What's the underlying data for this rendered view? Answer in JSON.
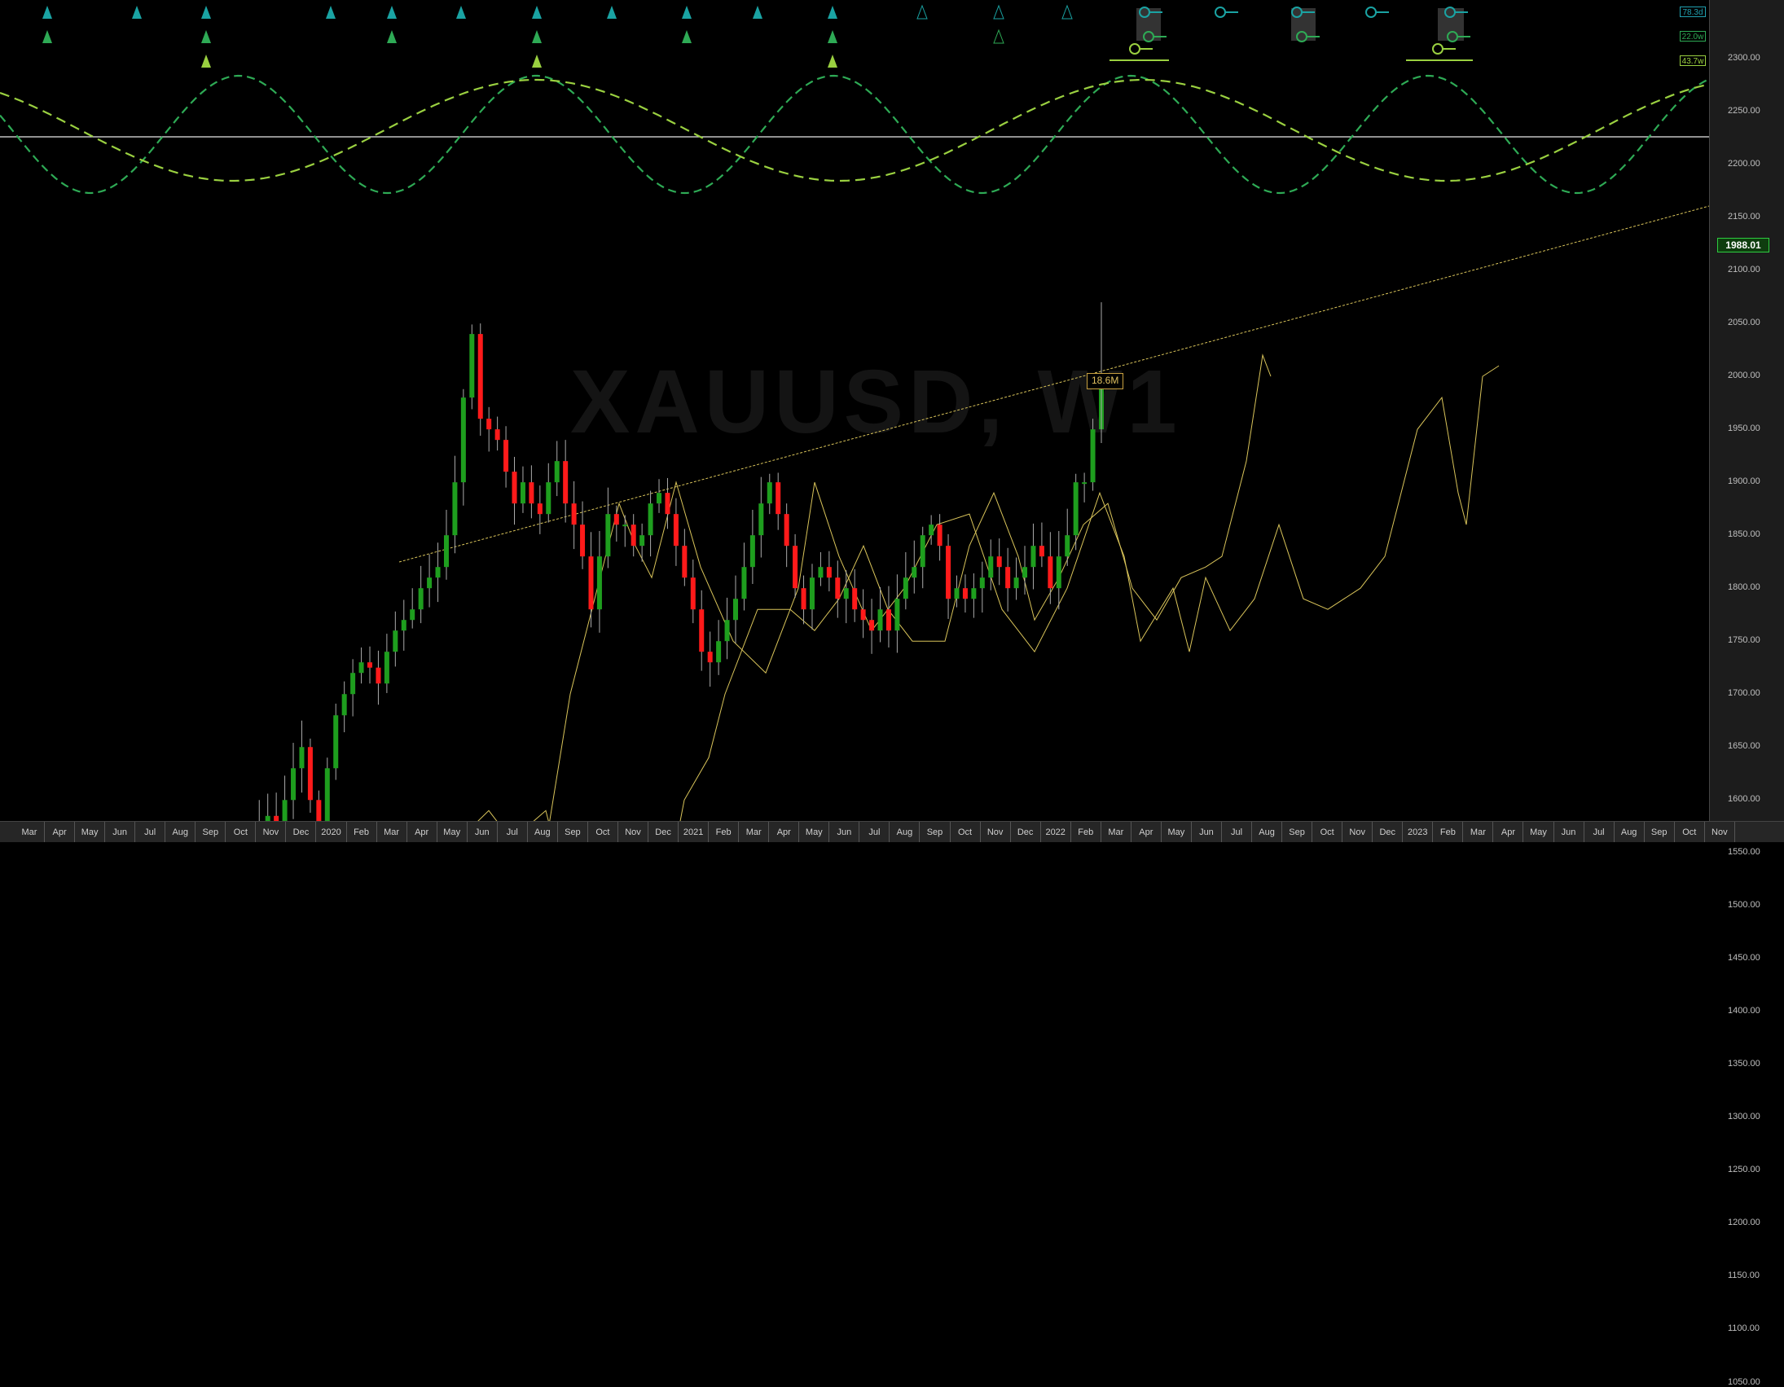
{
  "symbol_watermark": "XAUUSD, W1",
  "last_price": "1988.01",
  "volume_badge": "18.6M",
  "cycle_labels": [
    {
      "text": "78.3d",
      "color": "#20a0b0"
    },
    {
      "text": "22.0w",
      "color": "#2eaa55"
    },
    {
      "text": "43.7w",
      "color": "#9ad040"
    }
  ],
  "price_axis": {
    "ticks": [
      "2300.00",
      "2250.00",
      "2200.00",
      "2150.00",
      "2100.00",
      "2050.00",
      "2000.00",
      "1950.00",
      "1900.00",
      "1850.00",
      "1800.00",
      "1750.00",
      "1700.00",
      "1650.00",
      "1600.00",
      "1550.00",
      "1500.00",
      "1450.00",
      "1400.00",
      "1350.00",
      "1300.00",
      "1250.00",
      "1200.00",
      "1150.00",
      "1100.00",
      "1050.00"
    ]
  },
  "time_axis": {
    "labels": [
      "Mar",
      "Apr",
      "May",
      "Jun",
      "Jul",
      "Aug",
      "Sep",
      "Oct",
      "Nov",
      "Dec",
      "2020",
      "Feb",
      "Mar",
      "Apr",
      "May",
      "Jun",
      "Jul",
      "Aug",
      "Sep",
      "Oct",
      "Nov",
      "Dec",
      "2021",
      "Feb",
      "Mar",
      "Apr",
      "May",
      "Jun",
      "Jul",
      "Aug",
      "Sep",
      "Oct",
      "Nov",
      "Dec",
      "2022",
      "Feb",
      "Mar",
      "Apr",
      "May",
      "Jun",
      "Jul",
      "Aug",
      "Sep",
      "Oct",
      "Nov",
      "Dec",
      "2023",
      "Feb",
      "Mar",
      "Apr",
      "May",
      "Jun",
      "Jul",
      "Aug",
      "Sep",
      "Oct",
      "Nov"
    ]
  },
  "colors": {
    "background": "#000000",
    "bull_candle": "#1e9e1e",
    "bear_candle": "#ff1a1a",
    "cycle_78d": "#20a0b0",
    "cycle_22w": "#2eaa55",
    "cycle_43w": "#9ad040",
    "projection_line": "#d9c45a",
    "horizontal_level": "#e8e8e8"
  },
  "chart_data": {
    "type": "candlestick",
    "instrument": "XAUUSD",
    "timeframe": "W1",
    "last_price": 1988.01,
    "ylim": [
      1025,
      2325
    ]
  }
}
